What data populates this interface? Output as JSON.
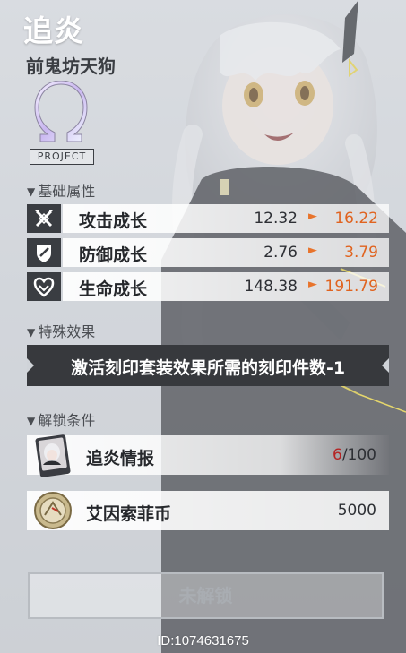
{
  "character": {
    "name": "追炎",
    "title": "前鬼坊天狗",
    "series_tag": "PROJECT"
  },
  "sections": {
    "base_stats": "基础属性",
    "special_effect": "特殊效果",
    "unlock_conditions": "解锁条件"
  },
  "stats": [
    {
      "label": "攻击成长",
      "from": "12.32",
      "to": "16.22",
      "icon": "crossed-swords-icon"
    },
    {
      "label": "防御成长",
      "from": "2.76",
      "to": "3.79",
      "icon": "shield-icon"
    },
    {
      "label": "生命成长",
      "from": "148.38",
      "to": "191.79",
      "icon": "heart-icon"
    }
  ],
  "stat_arrow": "►",
  "effect_text": "激活刻印套装效果所需的刻印件数-1",
  "requirements": [
    {
      "label": "追炎情报",
      "current": "6",
      "total": "/100",
      "icon": "intel-card-icon"
    },
    {
      "label": "艾因索菲币",
      "amount": "5000",
      "icon": "coin-icon"
    }
  ],
  "unlock_button": "未解锁",
  "footer_id": "ID:1074631675",
  "colors": {
    "accent_orange": "#e0631f",
    "current_count_red": "#b52424",
    "dark_panel": "#37393d"
  }
}
